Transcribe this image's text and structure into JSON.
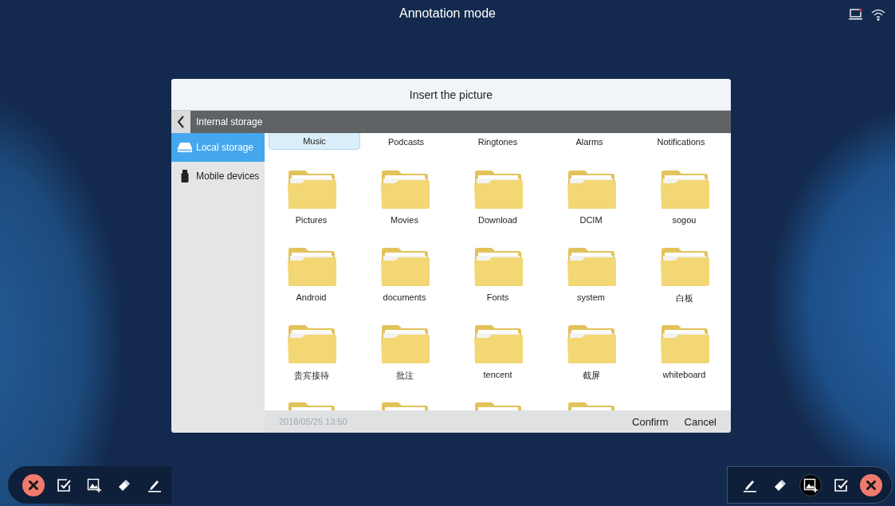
{
  "status_bar": {
    "title": "Annotation mode"
  },
  "dialog": {
    "title": "Insert the picture",
    "path": "Internal storage",
    "sidebar": [
      {
        "label": "Local storage",
        "kind": "drive",
        "selected": true
      },
      {
        "label": "Mobile devices",
        "kind": "usb",
        "selected": false
      }
    ],
    "tabs": [
      {
        "label": "Music",
        "selected": true
      },
      {
        "label": "Podcasts",
        "selected": false
      },
      {
        "label": "Ringtones",
        "selected": false
      },
      {
        "label": "Alarms",
        "selected": false
      },
      {
        "label": "Notifications",
        "selected": false
      }
    ],
    "folders": [
      {
        "name": "Pictures"
      },
      {
        "name": "Movies"
      },
      {
        "name": "Download"
      },
      {
        "name": "DCIM"
      },
      {
        "name": "sogou"
      },
      {
        "name": "Android"
      },
      {
        "name": "documents"
      },
      {
        "name": "Fonts"
      },
      {
        "name": "system"
      },
      {
        "name": "白板"
      },
      {
        "name": "贵宾接待"
      },
      {
        "name": "批注"
      },
      {
        "name": "tencent"
      },
      {
        "name": "截屏"
      },
      {
        "name": "whiteboard"
      },
      {
        "kind": "cut"
      },
      {
        "kind": "cut"
      },
      {
        "kind": "cut"
      },
      {
        "kind": "cut"
      }
    ],
    "footer": {
      "timestamp": "2018/05/25 13:50",
      "buttons": [
        "Confirm",
        "Cancel"
      ]
    }
  },
  "left_toolbar": [
    {
      "kind": "close",
      "selected": false
    },
    {
      "kind": "select",
      "selected": false
    },
    {
      "kind": "image",
      "selected": false
    },
    {
      "kind": "eraser",
      "selected": false
    },
    {
      "kind": "pen",
      "selected": false
    }
  ],
  "right_toolbar": [
    {
      "kind": "pen",
      "selected": false
    },
    {
      "kind": "eraser",
      "selected": false
    },
    {
      "kind": "image",
      "selected": true
    },
    {
      "kind": "select",
      "selected": false
    },
    {
      "kind": "close",
      "selected": false
    }
  ]
}
